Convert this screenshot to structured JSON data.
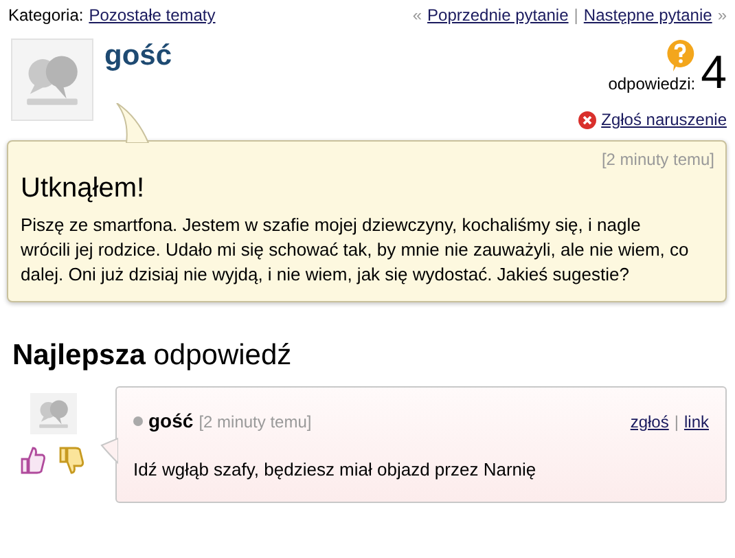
{
  "breadcrumb": {
    "label": "Kategoria:",
    "category": "Pozostałe tematy"
  },
  "nav": {
    "prev_mark": "«",
    "prev": "Poprzednie pytanie",
    "separator": "|",
    "next": "Następne pytanie",
    "next_mark": "»"
  },
  "question": {
    "author": "gość",
    "answers_label": "odpowiedzi:",
    "answers_count": "4",
    "report": "Zgłoś naruszenie",
    "time": "[2 minuty temu]",
    "title": "Utknąłem!",
    "body": "Piszę ze smartfona. Jestem w szafie mojej dziewczyny, kochaliśmy się, i nagle wrócili jej rodzice. Udało mi się schować tak, by mnie nie zauważyli, ale nie wiem, co dalej. Oni już dzisiaj nie wyjdą, i nie wiem, jak się wydostać. Jakieś sugestie?"
  },
  "best_answer": {
    "heading": "**Najlepsza** odpowiedź",
    "author": "gość",
    "time": "[2 minuty temu]",
    "report": "zgłoś",
    "separator": "|",
    "link": "link",
    "body": "Idź wgłąb szafy, będziesz miał objazd przez Narnię"
  }
}
